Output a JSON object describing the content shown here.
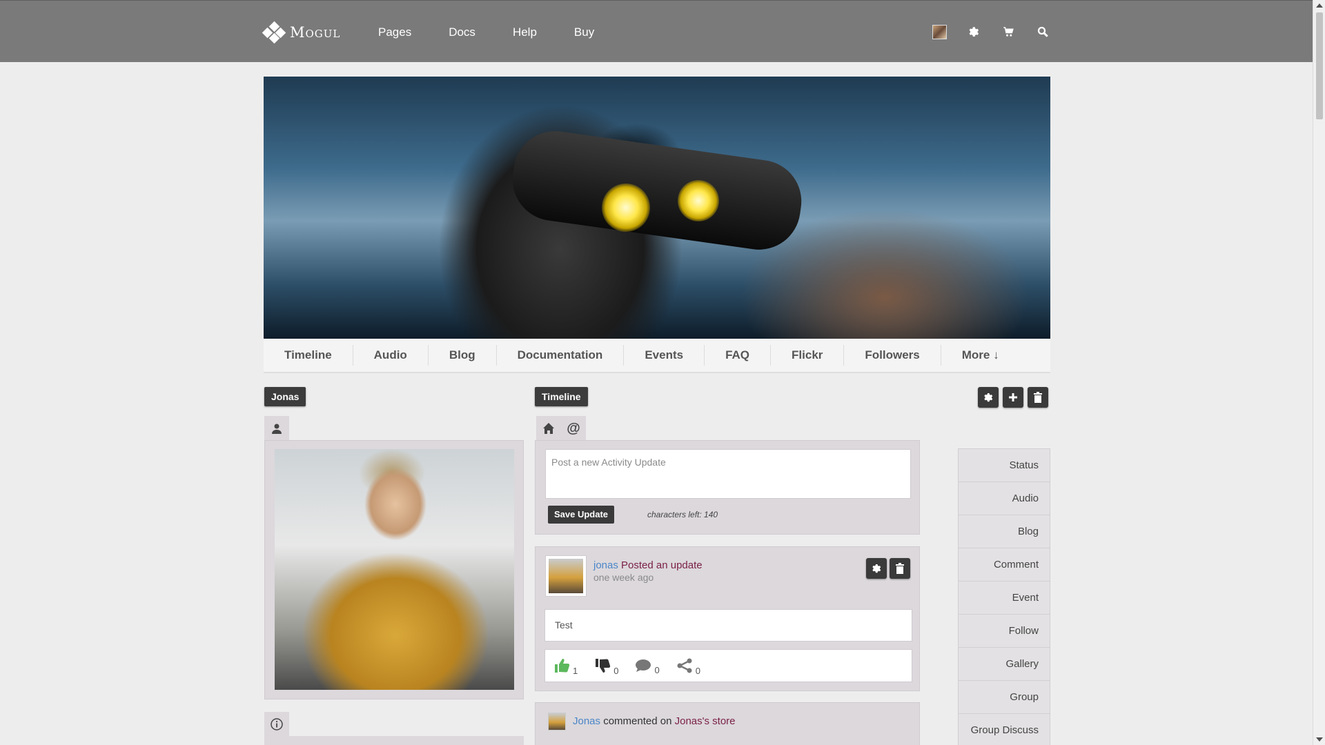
{
  "header": {
    "logo_text": "Mogul",
    "nav": [
      "Pages",
      "Docs",
      "Help",
      "Buy"
    ],
    "icons": [
      "user-avatar",
      "gear-icon",
      "cart-icon",
      "search-icon"
    ]
  },
  "profile_tabs": [
    "Timeline",
    "Audio",
    "Blog",
    "Documentation",
    "Events",
    "FAQ",
    "Flickr",
    "Followers",
    "More ↓"
  ],
  "left": {
    "tag": "Jonas"
  },
  "center": {
    "tag": "Timeline",
    "post_placeholder": "Post a new Activity Update",
    "save_label": "Save Update",
    "chars_left": "characters left: 140",
    "activity": {
      "user": "jonas",
      "action": "Posted an update",
      "time": "one week ago",
      "text": "Test",
      "likes": "1",
      "dislikes": "0",
      "comments": "0",
      "shares": "0"
    },
    "comment": {
      "user": "Jonas",
      "action": "commented on",
      "target": "Jonas's store"
    }
  },
  "right_menu": [
    "Status",
    "Audio",
    "Blog",
    "Comment",
    "Event",
    "Follow",
    "Gallery",
    "Group",
    "Group Discuss"
  ],
  "colors": {
    "topbar": "#7a7a7a",
    "page_bg": "#ededed",
    "panel_bg": "#dcd8dc",
    "link_blue": "#4a86c8",
    "link_maroon": "#7a1f45",
    "like_green": "#5cb85c"
  }
}
